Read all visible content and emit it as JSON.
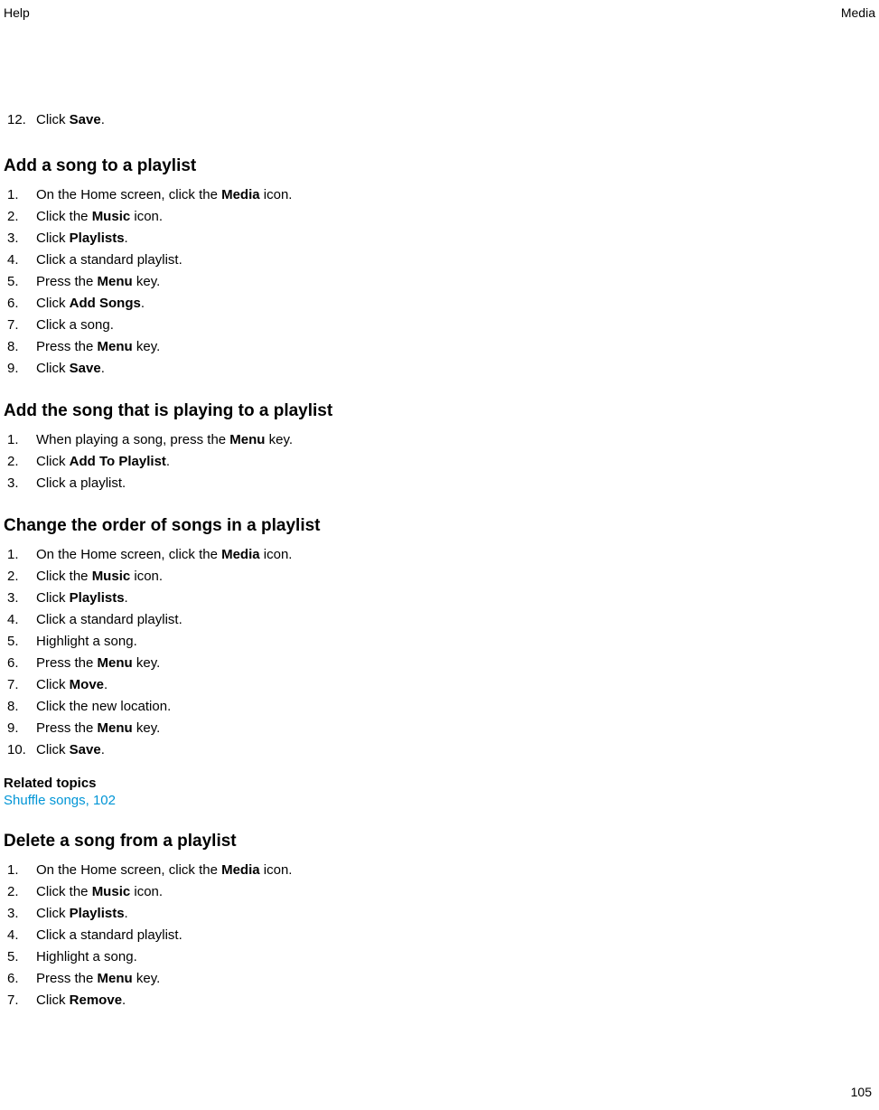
{
  "header": {
    "left": "Help",
    "right": "Media"
  },
  "continued": {
    "num": "12.",
    "text_pre": "Click ",
    "text_bold": "Save",
    "text_post": "."
  },
  "sections": [
    {
      "heading": "Add a song to a playlist",
      "items": [
        {
          "num": "1.",
          "parts": [
            {
              "t": "On the Home screen, click the "
            },
            {
              "b": "Media"
            },
            {
              "t": " icon."
            }
          ]
        },
        {
          "num": "2.",
          "parts": [
            {
              "t": "Click the "
            },
            {
              "b": "Music"
            },
            {
              "t": " icon."
            }
          ]
        },
        {
          "num": "3.",
          "parts": [
            {
              "t": "Click "
            },
            {
              "b": "Playlists"
            },
            {
              "t": "."
            }
          ]
        },
        {
          "num": "4.",
          "parts": [
            {
              "t": "Click a standard playlist."
            }
          ]
        },
        {
          "num": "5.",
          "parts": [
            {
              "t": "Press the "
            },
            {
              "b": "Menu"
            },
            {
              "t": " key."
            }
          ]
        },
        {
          "num": "6.",
          "parts": [
            {
              "t": "Click "
            },
            {
              "b": "Add Songs"
            },
            {
              "t": "."
            }
          ]
        },
        {
          "num": "7.",
          "parts": [
            {
              "t": "Click a song."
            }
          ]
        },
        {
          "num": "8.",
          "parts": [
            {
              "t": "Press the "
            },
            {
              "b": "Menu"
            },
            {
              "t": " key."
            }
          ]
        },
        {
          "num": "9.",
          "parts": [
            {
              "t": "Click "
            },
            {
              "b": "Save"
            },
            {
              "t": "."
            }
          ]
        }
      ]
    },
    {
      "heading": "Add the song that is playing to a playlist",
      "items": [
        {
          "num": "1.",
          "parts": [
            {
              "t": "When playing a song, press the "
            },
            {
              "b": "Menu"
            },
            {
              "t": " key."
            }
          ]
        },
        {
          "num": "2.",
          "parts": [
            {
              "t": "Click "
            },
            {
              "b": "Add To Playlist"
            },
            {
              "t": "."
            }
          ]
        },
        {
          "num": "3.",
          "parts": [
            {
              "t": "Click a playlist."
            }
          ]
        }
      ]
    },
    {
      "heading": "Change the order of songs in a playlist",
      "items": [
        {
          "num": "1.",
          "parts": [
            {
              "t": "On the Home screen, click the "
            },
            {
              "b": "Media"
            },
            {
              "t": " icon."
            }
          ]
        },
        {
          "num": "2.",
          "parts": [
            {
              "t": "Click the "
            },
            {
              "b": "Music"
            },
            {
              "t": " icon."
            }
          ]
        },
        {
          "num": "3.",
          "parts": [
            {
              "t": "Click "
            },
            {
              "b": "Playlists"
            },
            {
              "t": "."
            }
          ]
        },
        {
          "num": "4.",
          "parts": [
            {
              "t": "Click a standard playlist."
            }
          ]
        },
        {
          "num": "5.",
          "parts": [
            {
              "t": "Highlight a song."
            }
          ]
        },
        {
          "num": "6.",
          "parts": [
            {
              "t": "Press the "
            },
            {
              "b": "Menu"
            },
            {
              "t": " key."
            }
          ]
        },
        {
          "num": "7.",
          "parts": [
            {
              "t": "Click "
            },
            {
              "b": "Move"
            },
            {
              "t": "."
            }
          ]
        },
        {
          "num": "8.",
          "parts": [
            {
              "t": "Click the new location."
            }
          ]
        },
        {
          "num": "9.",
          "parts": [
            {
              "t": "Press the "
            },
            {
              "b": "Menu"
            },
            {
              "t": " key."
            }
          ]
        },
        {
          "num": "10.",
          "parts": [
            {
              "t": "Click "
            },
            {
              "b": "Save"
            },
            {
              "t": "."
            }
          ]
        }
      ],
      "related_label": "Related topics",
      "related_link": "Shuffle songs, 102"
    },
    {
      "heading": "Delete a song from a playlist",
      "items": [
        {
          "num": "1.",
          "parts": [
            {
              "t": "On the Home screen, click the "
            },
            {
              "b": "Media"
            },
            {
              "t": " icon."
            }
          ]
        },
        {
          "num": "2.",
          "parts": [
            {
              "t": "Click the "
            },
            {
              "b": "Music"
            },
            {
              "t": " icon."
            }
          ]
        },
        {
          "num": "3.",
          "parts": [
            {
              "t": "Click "
            },
            {
              "b": "Playlists"
            },
            {
              "t": "."
            }
          ]
        },
        {
          "num": "4.",
          "parts": [
            {
              "t": "Click a standard playlist."
            }
          ]
        },
        {
          "num": "5.",
          "parts": [
            {
              "t": "Highlight a song."
            }
          ]
        },
        {
          "num": "6.",
          "parts": [
            {
              "t": "Press the "
            },
            {
              "b": "Menu"
            },
            {
              "t": " key."
            }
          ]
        },
        {
          "num": "7.",
          "parts": [
            {
              "t": "Click "
            },
            {
              "b": "Remove"
            },
            {
              "t": "."
            }
          ]
        }
      ]
    }
  ],
  "page_number": "105"
}
